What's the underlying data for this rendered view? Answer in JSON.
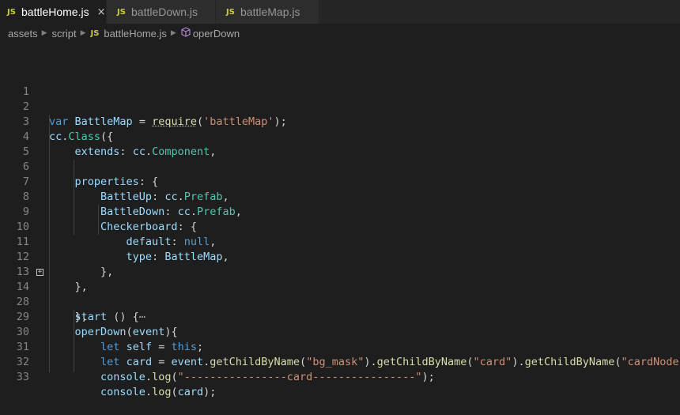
{
  "tabs": [
    {
      "badge": "JS",
      "label": "battleHome.js",
      "close": "×",
      "active": true
    },
    {
      "badge": "JS",
      "label": "battleDown.js",
      "active": false
    },
    {
      "badge": "JS",
      "label": "battleMap.js",
      "active": false
    }
  ],
  "breadcrumb": {
    "folder1": "assets",
    "folder2": "script",
    "file_badge": "JS",
    "file": "battleHome.js",
    "symbol": "operDown"
  },
  "colors": {
    "keyword": "#569cd6",
    "variable": "#9cdcfe",
    "function": "#dcdcaa",
    "string": "#ce9178",
    "type": "#4ec9b0"
  },
  "lines": [
    {
      "num": "1"
    },
    {
      "num": "2",
      "t": [
        "var",
        "BattleMap",
        " = ",
        "require",
        "(",
        "'battleMap'",
        ");"
      ]
    },
    {
      "num": "3",
      "t": [
        "cc",
        ".",
        "Class",
        "({"
      ]
    },
    {
      "num": "4",
      "t": [
        "extends",
        ": ",
        "cc",
        ".",
        "Component",
        ","
      ]
    },
    {
      "num": "5"
    },
    {
      "num": "6",
      "t": [
        "properties",
        ": {"
      ]
    },
    {
      "num": "7",
      "t": [
        "BattleUp",
        ": ",
        "cc",
        ".",
        "Prefab",
        ","
      ]
    },
    {
      "num": "8",
      "t": [
        "BattleDown",
        ": ",
        "cc",
        ".",
        "Prefab",
        ","
      ]
    },
    {
      "num": "9",
      "t": [
        "Checkerboard",
        ": {"
      ]
    },
    {
      "num": "10",
      "t": [
        "default",
        ": ",
        "null",
        ","
      ]
    },
    {
      "num": "11",
      "t": [
        "type",
        ": ",
        "BattleMap",
        ","
      ]
    },
    {
      "num": "12",
      "t": [
        "},"
      ]
    },
    {
      "num": "13",
      "t": [
        "},"
      ]
    },
    {
      "num": "14",
      "fold": "+",
      "t": [
        "start",
        " () {",
        "⋯"
      ]
    },
    {
      "num": "28",
      "t": [
        "},"
      ]
    },
    {
      "num": "29",
      "t": [
        "operDown",
        "(",
        "event",
        "){"
      ]
    },
    {
      "num": "30",
      "t": [
        "let",
        "self",
        " = ",
        "this",
        ";"
      ]
    },
    {
      "num": "31",
      "t": [
        "let",
        "card",
        " = ",
        "event",
        ".",
        "getChildByName",
        "(",
        "\"bg_mask\"",
        ").",
        "getChildByName",
        "(",
        "\"card\"",
        ").",
        "getChildByName",
        "(",
        "\"cardNode\"",
        ");"
      ]
    },
    {
      "num": "32",
      "t": [
        "console",
        ".",
        "log",
        "(",
        "\"----------------card----------------\"",
        ");"
      ]
    },
    {
      "num": "33",
      "t": [
        "console",
        ".",
        "log",
        "(",
        "card",
        ");"
      ]
    }
  ]
}
